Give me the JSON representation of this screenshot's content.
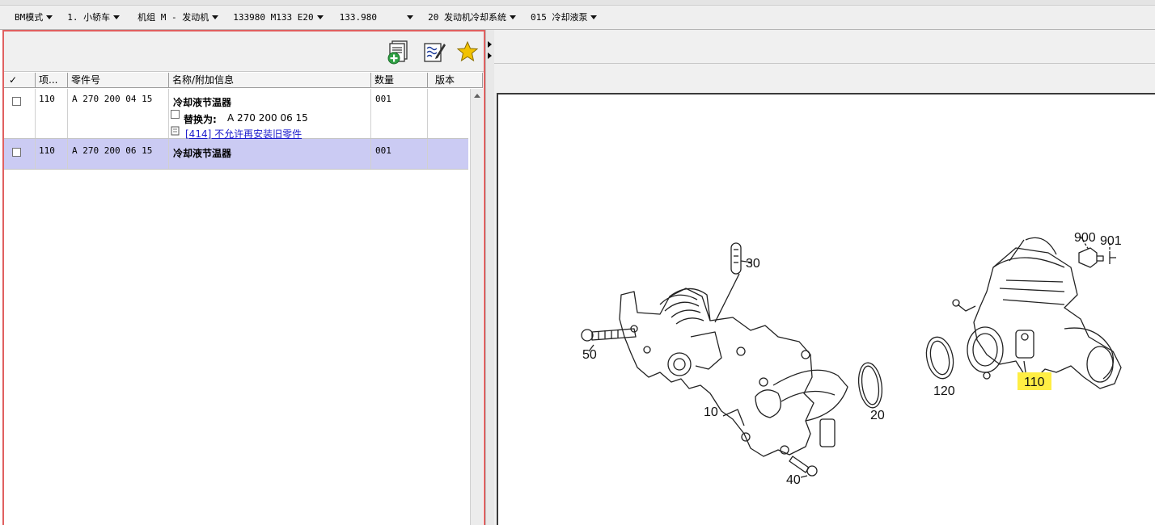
{
  "breadcrumb": [
    {
      "label": "BM模式",
      "has_menu": true
    },
    {
      "label": "1. 小轿车",
      "has_menu": true
    },
    {
      "label": "机组 M  - 发动机",
      "has_menu": true
    },
    {
      "label": "133980 M133 E20",
      "has_menu": true
    },
    {
      "label": "133.980     ",
      "has_menu": true
    },
    {
      "label": "20 发动机冷却系统",
      "has_menu": true
    },
    {
      "label": "015 冷却液泵",
      "has_menu": true
    }
  ],
  "toolbar": {
    "icons": [
      "add-to-list-icon",
      "edit-notes-icon",
      "favorite-star-icon"
    ],
    "accent_green": "#2ea043",
    "star_color": "#f2c200"
  },
  "table": {
    "columns": [
      "✓",
      "项...",
      "零件号",
      "名称/附加信息",
      "数量",
      "版本"
    ],
    "rows": [
      {
        "item": "110",
        "part_number": "A 270 200 04 15",
        "name": "冷却液节温器",
        "replace_label": "替换为:",
        "replace_value": "A 270 200 06 15",
        "note": "[414] 不允许再安装旧零件",
        "qty": "001",
        "version": "",
        "selected": false
      },
      {
        "item": "110",
        "part_number": "A 270 200 06 15",
        "name": "冷却液节温器",
        "qty": "001",
        "version": "",
        "selected": true
      }
    ]
  },
  "diagram": {
    "callouts": [
      "30",
      "50",
      "10",
      "20",
      "40",
      "900",
      "901",
      "120",
      "110"
    ],
    "highlighted": "110",
    "highlight_color": "#ffee44"
  },
  "colors": {
    "selection": "#cbcbf3",
    "panel_border": "#e06060",
    "link": "#1a1acc"
  }
}
